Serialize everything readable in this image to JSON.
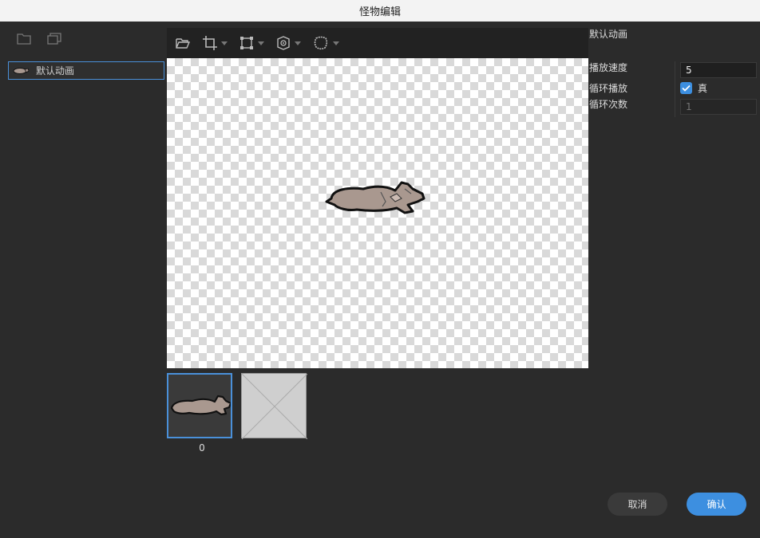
{
  "window": {
    "title": "怪物编辑"
  },
  "left_panel": {
    "tools": [
      {
        "icon": "folder-icon"
      },
      {
        "icon": "copy-icon"
      }
    ],
    "animations": [
      {
        "label": "默认动画",
        "selected": true
      }
    ]
  },
  "canvas_toolbar": {
    "buttons": [
      {
        "icon": "open-folder-icon",
        "has_dropdown": false
      },
      {
        "icon": "crop-icon",
        "has_dropdown": true
      },
      {
        "icon": "transform-icon",
        "has_dropdown": true
      },
      {
        "icon": "target-icon",
        "has_dropdown": true
      },
      {
        "icon": "outline-icon",
        "has_dropdown": true
      }
    ]
  },
  "frames": [
    {
      "index_label": "0",
      "selected": true,
      "empty": false
    },
    {
      "index_label": "",
      "selected": false,
      "empty": true
    }
  ],
  "right_panel": {
    "title": "默认动画",
    "speed_label": "播放速度",
    "speed_value": "5",
    "loop_label": "循环播放",
    "loop_checked": true,
    "loop_value_label": "真",
    "loop_count_label": "循环次数",
    "loop_count_placeholder": "1"
  },
  "buttons": {
    "cancel": "取消",
    "confirm": "确认"
  },
  "colors": {
    "accent": "#3d8fe0",
    "background": "#2b2b2b",
    "titlebar": "#f3f3f3"
  }
}
